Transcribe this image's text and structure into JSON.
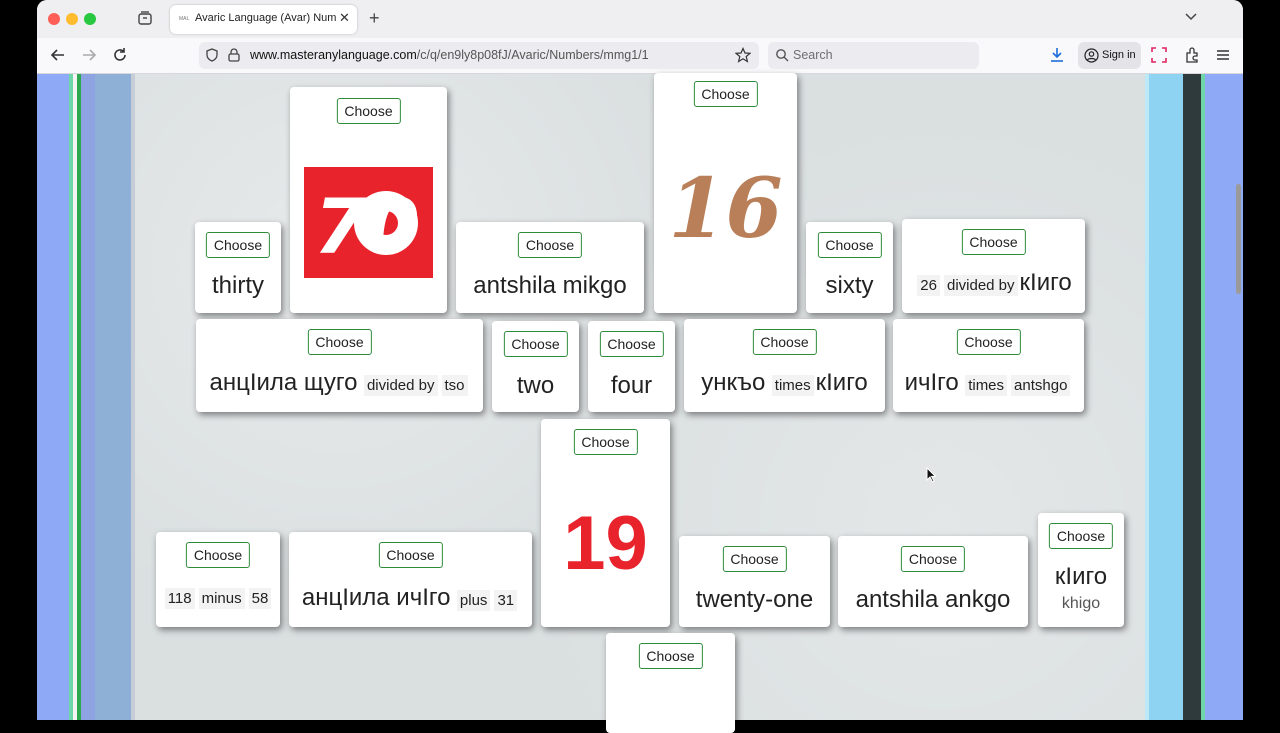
{
  "browser": {
    "tab_title": "Avaric Language (Avar) Numbers",
    "tab_favicon": "MAL",
    "url_domain": "www.masteranylanguage.com",
    "url_path": "/c/q/en9ly8p08fJ/Avaric/Numbers/mmg1/1",
    "search_placeholder": "Search",
    "sign_in": "Sign in"
  },
  "button_label": "Choose",
  "cards": {
    "c70": {
      "image_number": "70",
      "image_bg": "#e8232c"
    },
    "c16": {
      "image_number": "16",
      "image_color": "#b97f58"
    },
    "thirty": {
      "text": "thirty"
    },
    "antshila_mikgo": {
      "text": "antshila mikgo"
    },
    "sixty": {
      "text": "sixty"
    },
    "div26": {
      "a": "26",
      "op": "divided by",
      "b": "кIиго"
    },
    "antsila_schugo": {
      "a": "анцIила щуго",
      "op": "divided by",
      "b": "tso"
    },
    "two": {
      "text": "two"
    },
    "four": {
      "text": "four"
    },
    "unkyo": {
      "a": "ункъо",
      "op": "times",
      "b": "кIиго"
    },
    "ichgo": {
      "a": "ичIго",
      "op": "times",
      "b": "antshgo"
    },
    "c19": {
      "image_number": "19",
      "image_color": "#e8232c"
    },
    "minus": {
      "a": "118",
      "op": "minus",
      "b": "58"
    },
    "plus": {
      "a": "анцIила ичIго",
      "op": "plus",
      "b": "31"
    },
    "twentyone": {
      "text": "twenty-one"
    },
    "antshila_ankgo": {
      "text": "antshila ankgo"
    },
    "kigo": {
      "text": "кIиго",
      "roman": "khigo"
    }
  }
}
